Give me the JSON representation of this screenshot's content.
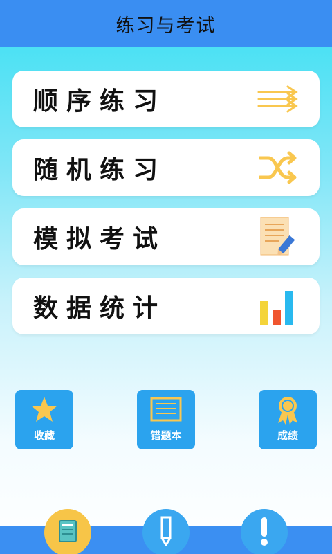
{
  "header": {
    "title": "练习与考试"
  },
  "menu": {
    "items": [
      {
        "label": "顺序练习",
        "icon": "arrows-right-icon"
      },
      {
        "label": "随机练习",
        "icon": "shuffle-icon"
      },
      {
        "label": "模拟考试",
        "icon": "exam-paper-icon"
      },
      {
        "label": "数据统计",
        "icon": "bar-chart-icon"
      }
    ]
  },
  "quick": {
    "items": [
      {
        "label": "收藏",
        "icon": "star-icon"
      },
      {
        "label": "错题本",
        "icon": "notebook-icon"
      },
      {
        "label": "成绩",
        "icon": "award-ribbon-icon"
      }
    ]
  },
  "tabbar": {
    "items": [
      {
        "icon": "book-icon",
        "color": "#f7c548"
      },
      {
        "icon": "pencil-icon",
        "color": "#3aa7f0"
      },
      {
        "icon": "exclamation-icon",
        "color": "#3aa7f0"
      }
    ]
  },
  "colors": {
    "accent": "#3a8ef2",
    "quick_button": "#2ba3ee",
    "icon_yellow": "#f9c74f"
  }
}
